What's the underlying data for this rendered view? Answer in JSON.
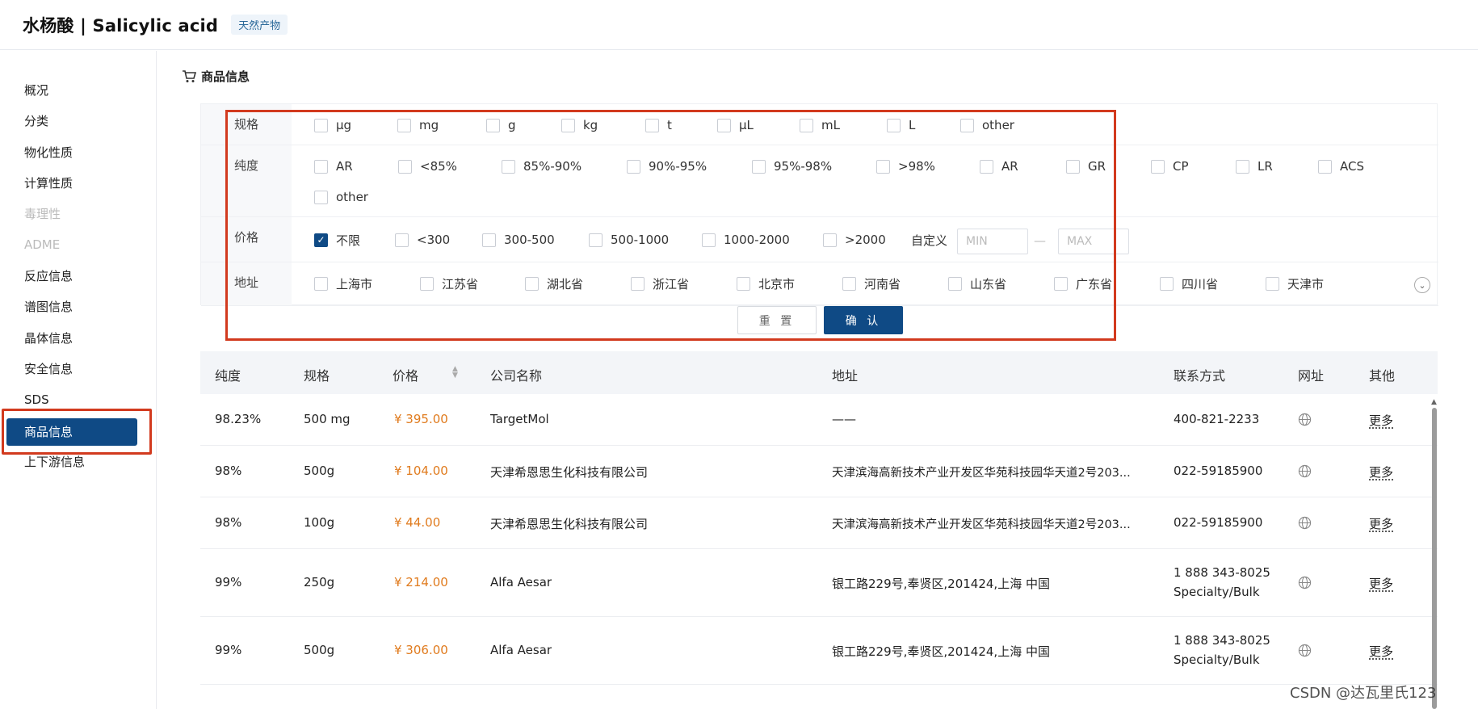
{
  "header": {
    "title": "水杨酸 | Salicylic acid",
    "tag": "天然产物"
  },
  "sidebar": {
    "items": [
      {
        "label": "概况"
      },
      {
        "label": "分类"
      },
      {
        "label": "物化性质"
      },
      {
        "label": "计算性质"
      },
      {
        "label": "毒理性"
      },
      {
        "label": "ADME"
      },
      {
        "label": "反应信息"
      },
      {
        "label": "谱图信息"
      },
      {
        "label": "晶体信息"
      },
      {
        "label": "安全信息"
      },
      {
        "label": "SDS"
      },
      {
        "label": "商品信息"
      },
      {
        "label": "上下游信息"
      }
    ]
  },
  "section": {
    "title": "商品信息"
  },
  "filters": {
    "spec": {
      "label": "规格",
      "options": [
        "μg",
        "mg",
        "g",
        "kg",
        "t",
        "μL",
        "mL",
        "L",
        "other"
      ]
    },
    "purity": {
      "label": "纯度",
      "options": [
        "AR",
        "<85%",
        "85%-90%",
        "90%-95%",
        "95%-98%",
        ">98%",
        "AR",
        "GR",
        "CP",
        "LR",
        "ACS",
        "other"
      ]
    },
    "price": {
      "label": "价格",
      "options": [
        "不限",
        "<300",
        "300-500",
        "500-1000",
        "1000-2000",
        ">2000"
      ],
      "custom_label": "自定义",
      "min_placeholder": "MIN",
      "max_placeholder": "MAX",
      "separator": "—"
    },
    "address": {
      "label": "地址",
      "options": [
        "上海市",
        "江苏省",
        "湖北省",
        "浙江省",
        "北京市",
        "河南省",
        "山东省",
        "广东省",
        "四川省",
        "天津市"
      ]
    },
    "reset_label": "重 置",
    "confirm_label": "确 认"
  },
  "table": {
    "headers": {
      "purity": "纯度",
      "spec": "规格",
      "price": "价格",
      "company": "公司名称",
      "address": "地址",
      "contact": "联系方式",
      "website": "网址",
      "other": "其他"
    },
    "rows": [
      {
        "purity": "98.23%",
        "spec": "500 mg",
        "price": "¥ 395.00",
        "company": "TargetMol",
        "address": "——",
        "contact": "400-821-2233",
        "contact2": "",
        "more": "更多"
      },
      {
        "purity": "98%",
        "spec": "500g",
        "price": "¥ 104.00",
        "company": "天津希恩思生化科技有限公司",
        "address": "天津滨海高新技术产业开发区华苑科技园华天道2号203...",
        "contact": "022-59185900",
        "contact2": "",
        "more": "更多"
      },
      {
        "purity": "98%",
        "spec": "100g",
        "price": "¥ 44.00",
        "company": "天津希恩思生化科技有限公司",
        "address": "天津滨海高新技术产业开发区华苑科技园华天道2号203...",
        "contact": "022-59185900",
        "contact2": "",
        "more": "更多"
      },
      {
        "purity": "99%",
        "spec": "250g",
        "price": "¥ 214.00",
        "company": "Alfa Aesar",
        "address": "银工路229号,奉贤区,201424,上海 中国",
        "contact": "1 888 343-8025",
        "contact2": "Specialty/Bulk",
        "more": "更多"
      },
      {
        "purity": "99%",
        "spec": "500g",
        "price": "¥ 306.00",
        "company": "Alfa Aesar",
        "address": "银工路229号,奉贤区,201424,上海 中国",
        "contact": "1 888 343-8025",
        "contact2": "Specialty/Bulk",
        "more": "更多"
      }
    ]
  },
  "watermark": "CSDN @达瓦里氏123",
  "colors": {
    "accent": "#0f4a85",
    "price": "#e07b1e",
    "highlight": "#d23a1e"
  }
}
